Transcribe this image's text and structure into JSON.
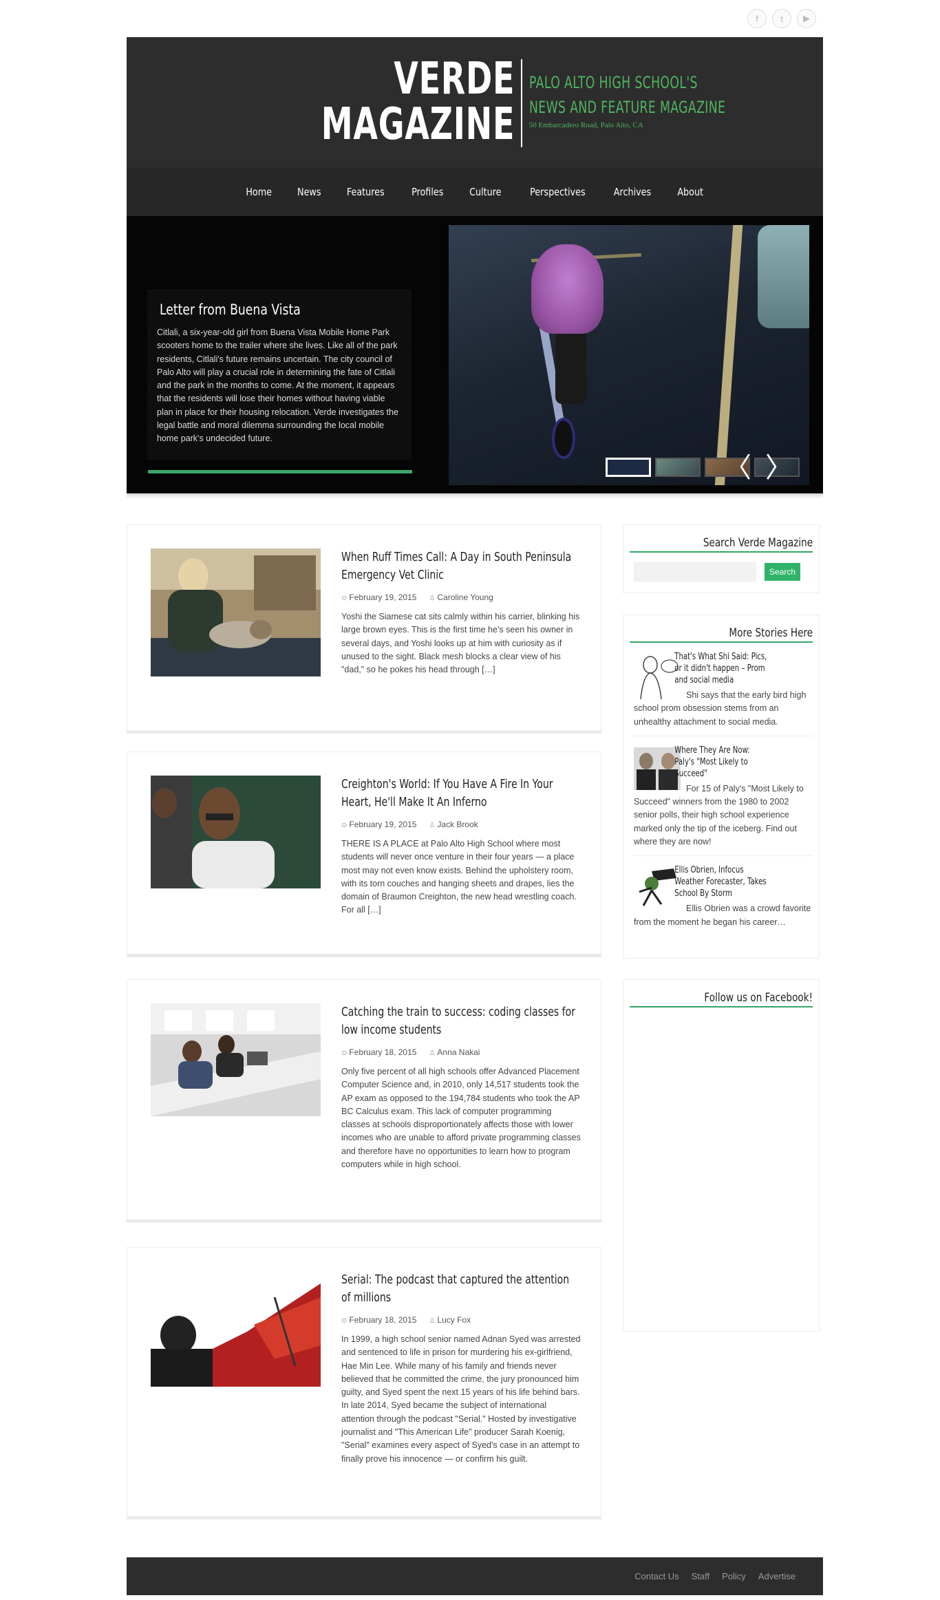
{
  "social": {
    "icons": [
      "facebook-icon",
      "twitter-icon",
      "youtube-icon"
    ],
    "glyphs": [
      "f",
      "t",
      "▶"
    ]
  },
  "header": {
    "logo_line1": "VERDE",
    "logo_line2": "MAGAZINE",
    "tagline_line1": "PALO ALTO HIGH SCHOOL'S",
    "tagline_line2": "NEWS AND FEATURE MAGAZINE",
    "address": "50 Embarcadero Road, Palo Alto, CA",
    "accent_color": "#4fb55f"
  },
  "nav": {
    "items": [
      "Home",
      "News",
      "Features",
      "Profiles",
      "Culture",
      "Perspectives",
      "Archives",
      "About"
    ]
  },
  "slider": {
    "title": "Letter from Buena Vista",
    "text": "Citlali, a six-year-old girl from Buena Vista Mobile Home Park scooters home to the trailer where she lives. Like all of the park residents, Citlali's future remains uncertain. The city council of Palo Alto will play a crucial role in determining the fate of Citlali and the park in the months to come. At the moment, it appears that the residents will lose their homes without having viable plan in place for their housing relocation. Verde investigates the legal battle and moral dilemma surrounding the local mobile home park's undecided future.",
    "prev_glyph": "〈",
    "next_glyph": "〉"
  },
  "posts": [
    {
      "title": "When Ruff Times Call: A Day in South Peninsula Emergency Vet Clinic",
      "date": "February 19, 2015",
      "author": "Caroline Young",
      "excerpt": "Yoshi the Siamese cat sits calmly within his carrier, blinking his large brown eyes. This is the first time he's seen his owner in several days, and Yoshi looks up at him with curiosity as if unused to the sight. Black mesh blocks a clear view of his \"dad,\" so he pokes his head through […]"
    },
    {
      "title": "Creighton's World: If You Have A Fire In Your Heart, He'll Make It An Inferno",
      "date": "February 19, 2015",
      "author": "Jack Brook",
      "excerpt": "THERE IS A PLACE at Palo Alto High School where most students will never once venture in their four years — a place most may not even know exists. Behind the upholstery room, with its torn couches and hanging sheets and drapes, lies the domain of Braumon Creighton, the new head wrestling coach. For all […]"
    },
    {
      "title": "Catching the train to success: coding classes for low income students",
      "date": "February 18, 2015",
      "author": "Anna Nakai",
      "excerpt": "Only five percent of all high schools offer Advanced Placement Computer Science and, in 2010, only 14,517 students took the AP exam as opposed to the 194,784 students who took the AP BC Calculus exam. This lack of computer programming classes at schools disproportionately affects those with lower incomes who are unable to afford private programming classes and therefore have no opportunities to learn how to program computers while in high school."
    },
    {
      "title": "Serial: The podcast that captured the attention of millions",
      "date": "February 18, 2015",
      "author": "Lucy Fox",
      "excerpt": "In 1999, a high school senior named Adnan Syed was arrested and sentenced to life in prison for murdering his ex-girlfriend, Hae Min Lee. While many of his family and friends never believed that he committed the crime, the jury pronounced him guilty, and Syed spent the next 15 years of his life behind bars. In late 2014, Syed became the subject of international attention through the podcast \"Serial.\" Hosted by investigative journalist and \"This American Life\" producer Sarah Koenig, \"Serial\" examines every aspect of Syed's case in an attempt to finally prove his innocence — or confirm his guilt."
    }
  ],
  "sidebar": {
    "search_title": "Search Verde Magazine",
    "search_placeholder": "",
    "search_button": "Search",
    "more_title": "More Stories Here",
    "stories": [
      {
        "title": "That's What Shi Said: Pics, or it didn't happen – Prom and social media",
        "desc": "Shi says that the early bird high school prom obsession stems from an unhealthy attachment to social media."
      },
      {
        "title": "Where They Are Now: Paly's \"Most Likely to Succeed\"",
        "desc": "For 15 of Paly's \"Most Likely to Succeed\" winners from the 1980 to 2002 senior polls, their high school experience marked only the tip of the iceberg. Find out where they are now!"
      },
      {
        "title": "Ellis Obrien, Infocus Weather Forecaster, Takes School By Storm",
        "desc": "Ellis Obrien was a crowd favorite from the moment he began his career…"
      }
    ],
    "facebook_title": "Follow us on Facebook!"
  },
  "footer": {
    "links": [
      "Contact Us",
      "Staff",
      "Policy",
      "Advertise"
    ]
  },
  "colors": {
    "header_bg": "#2d2d2d",
    "accent_green": "#2fb368"
  }
}
